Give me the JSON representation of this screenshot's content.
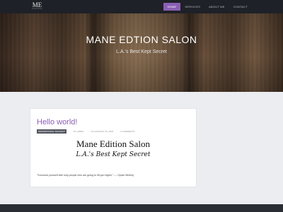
{
  "site": {
    "logo_text": "ME",
    "logo_sub": "MANE EDITION"
  },
  "nav": {
    "items": [
      {
        "label": "HOME",
        "active": true
      },
      {
        "label": "SERVICES",
        "active": false
      },
      {
        "label": "ABOUT ME",
        "active": false
      },
      {
        "label": "CONTACT",
        "active": false
      }
    ]
  },
  "hero": {
    "title": "MANE EDTION SALON",
    "subtitle": "L.A.'s Best Kept Secret"
  },
  "post": {
    "title": "Hello world!",
    "category": "INSPIRATIONAL THOUGHT",
    "author": "BY ADMIN",
    "date": "ON JANUARY 30, 2018",
    "comments": "0 COMMENTS",
    "image_title": "Mane Edition Salon",
    "image_tagline": "L.A.'s Best Kept Secret",
    "quote": "\"Surround yourself with only people who are going to lift you higher.\" — Oprah Winfrey"
  },
  "colors": {
    "accent": "#8b5fb3",
    "navbar_bg": "#1e2127",
    "page_bg": "#ecedf0"
  }
}
